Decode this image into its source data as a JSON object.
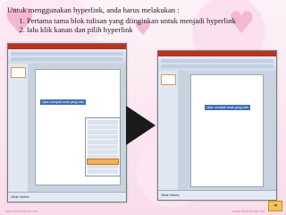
{
  "instructions": {
    "intro": "Untuk menggunakan hyperlink, anda harus melakukan :",
    "steps": [
      "Pertama tama blok tulisan yang diinginkan untuk menjadi hyperlink",
      "lalu klik kanan dan pilih hyperlink"
    ]
  },
  "screenshot_left": {
    "selected_text": "Ujian menjadi anak yang baik",
    "status_text": "Slide Notes"
  },
  "screenshot_right": {
    "selected_text": "Ujian menjadi anak yang baik",
    "status_text": "Slide Notes"
  },
  "footer": {
    "watermark_left": "www.SlideShare.net",
    "watermark_right": "www.SlideShare.net",
    "nav_icon": "next-arrow-icon"
  },
  "colors": {
    "accent_arrow": "#1a1a1a",
    "nav_button": "#f6c25b",
    "background_pink": "#f9dcea"
  }
}
